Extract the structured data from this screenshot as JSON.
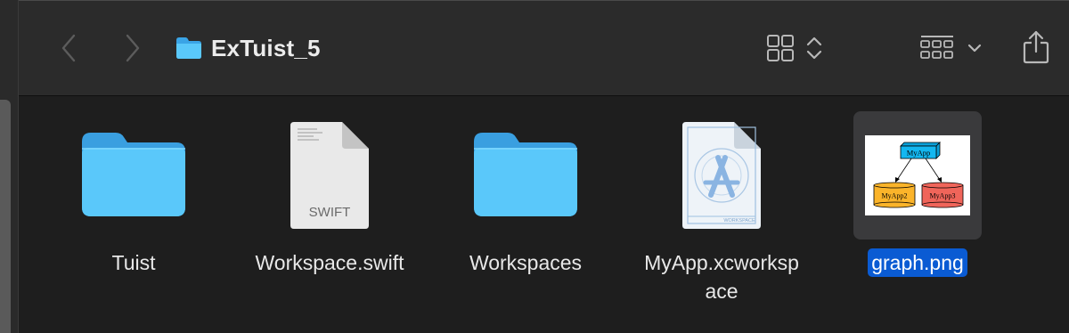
{
  "window": {
    "title": "ExTuist_5"
  },
  "toolbar": {
    "back_icon": "chevron-left-icon",
    "forward_icon": "chevron-right-icon",
    "folder_icon": "folder-icon",
    "view_icon": "icon-grid-icon",
    "view_updown_icon": "chevron-updown-icon",
    "group_icon": "group-by-icon",
    "group_chevron_icon": "chevron-down-icon",
    "share_icon": "share-icon"
  },
  "files": [
    {
      "name": "Tuist",
      "kind": "folder"
    },
    {
      "name": "Workspace.swift",
      "kind": "swift",
      "badge": "SWIFT"
    },
    {
      "name": "Workspaces",
      "kind": "folder"
    },
    {
      "name": "MyApp.xcworkspace",
      "kind": "xcworkspace",
      "badge": "WORKSPACE"
    },
    {
      "name": "graph.png",
      "kind": "png",
      "selected": true
    }
  ],
  "graph_thumbnail": {
    "nodes": [
      "MyApp",
      "MyApp2",
      "MyApp3"
    ]
  },
  "colors": {
    "folder": "#5ac8fa",
    "selection": "#0a5bd3",
    "background": "#1e1e1e",
    "toolbar": "#2b2b2b"
  }
}
